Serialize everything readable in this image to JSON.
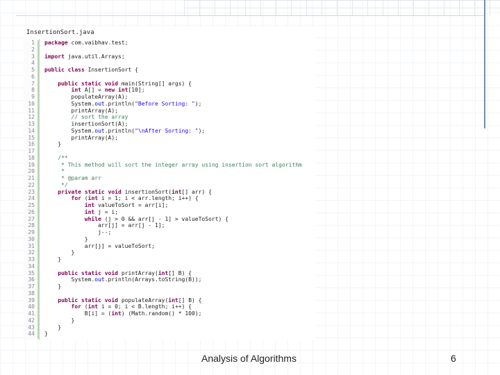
{
  "editor": {
    "file_tab": "InsertionSort.java",
    "lines": [
      {
        "n": "1",
        "t": "package com.vaibhav.test;"
      },
      {
        "n": "2",
        "t": ""
      },
      {
        "n": "3",
        "t": "import java.util.Arrays;"
      },
      {
        "n": "4",
        "t": ""
      },
      {
        "n": "5",
        "t": "public class InsertionSort {"
      },
      {
        "n": "6",
        "t": ""
      },
      {
        "n": "7",
        "t": "    public static void main(String[] args) {"
      },
      {
        "n": "8",
        "t": "        int A[] = new int[10];"
      },
      {
        "n": "9",
        "t": "        populateArray(A);"
      },
      {
        "n": "10",
        "t": "        System.out.println(\"Before Sorting: \");"
      },
      {
        "n": "11",
        "t": "        printArray(A);"
      },
      {
        "n": "12",
        "t": "        // sort the array"
      },
      {
        "n": "13",
        "t": "        insertionSort(A);"
      },
      {
        "n": "14",
        "t": "        System.out.println(\"\\nAfter Sorting: \");"
      },
      {
        "n": "15",
        "t": "        printArray(A);"
      },
      {
        "n": "16",
        "t": "    }"
      },
      {
        "n": "17",
        "t": ""
      },
      {
        "n": "18",
        "t": "    /**"
      },
      {
        "n": "19",
        "t": "     * This method will sort the integer array using insertion sort algorithm"
      },
      {
        "n": "20",
        "t": "     *"
      },
      {
        "n": "21",
        "t": "     * @param arr"
      },
      {
        "n": "22",
        "t": "     */"
      },
      {
        "n": "23",
        "t": "    private static void insertionSort(int[] arr) {"
      },
      {
        "n": "24",
        "t": "        for (int i = 1; i < arr.length; i++) {"
      },
      {
        "n": "25",
        "t": "            int valueToSort = arr[i];"
      },
      {
        "n": "26",
        "t": "            int j = i;"
      },
      {
        "n": "27",
        "t": "            while (j > 0 && arr[j - 1] > valueToSort) {"
      },
      {
        "n": "28",
        "t": "                arr[j] = arr[j - 1];"
      },
      {
        "n": "29",
        "t": "                j--;"
      },
      {
        "n": "30",
        "t": "            }"
      },
      {
        "n": "31",
        "t": "            arr[j] = valueToSort;"
      },
      {
        "n": "32",
        "t": "        }"
      },
      {
        "n": "33",
        "t": "    }"
      },
      {
        "n": "34",
        "t": ""
      },
      {
        "n": "35",
        "t": "    public static void printArray(int[] B) {"
      },
      {
        "n": "36",
        "t": "        System.out.println(Arrays.toString(B));"
      },
      {
        "n": "37",
        "t": "    }"
      },
      {
        "n": "38",
        "t": ""
      },
      {
        "n": "39",
        "t": "    public static void populateArray(int[] B) {"
      },
      {
        "n": "40",
        "t": "        for (int i = 0; i < B.length; i++) {"
      },
      {
        "n": "41",
        "t": "            B[i] = (int) (Math.random() * 100);"
      },
      {
        "n": "42",
        "t": "        }"
      },
      {
        "n": "43",
        "t": "    }"
      },
      {
        "n": "44",
        "t": "}"
      }
    ]
  },
  "footer": {
    "title": "Analysis of Algorithms",
    "page_number": "6"
  },
  "colors": {
    "keyword": "#7f0055",
    "comment": "#3f7f5f",
    "string": "#2a00ff",
    "line_number": "#7e8792"
  }
}
